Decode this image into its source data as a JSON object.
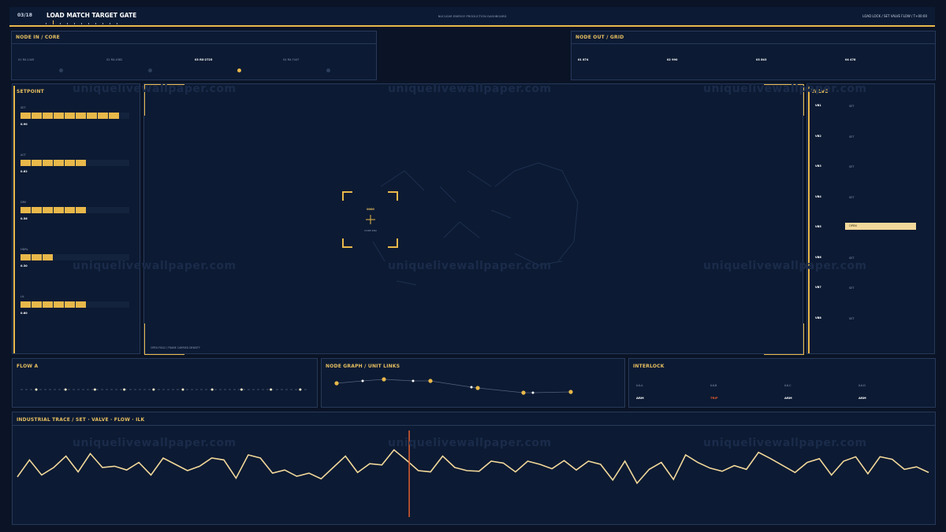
{
  "header": {
    "page_counter": "03/18",
    "title": "LOAD MATCH TARGET GATE",
    "subtitle": "NUCLEAR ENERGY PRODUCTION DASHBOARD",
    "right_status": "LOAD LOCK / SET VALVE FLOW / T+00:00"
  },
  "node_in": {
    "title": "NODE IN / CORE",
    "items": [
      {
        "label": "01 RX-1445",
        "active": false
      },
      {
        "label": "02 RX-4382",
        "active": false
      },
      {
        "label": "03 RX-2725",
        "active": true
      },
      {
        "label": "04 RX-7447",
        "active": false
      }
    ]
  },
  "node_out": {
    "title": "NODE OUT / GRID",
    "items": [
      "01 874",
      "02 990",
      "03 843",
      "04 478"
    ]
  },
  "setpoint": {
    "title": "SETPOINT",
    "rows": [
      {
        "label": "SET",
        "value": "0.90",
        "fill": 0.9
      },
      {
        "label": "ACT",
        "value": "0.62",
        "fill": 0.6
      },
      {
        "label": "DRV",
        "value": "0.56",
        "fill": 0.6
      },
      {
        "label": "HDRL",
        "value": "0.30",
        "fill": 0.3
      },
      {
        "label": "LIL",
        "value": "0.60",
        "fill": 0.6
      }
    ]
  },
  "center": {
    "reticle_label": "0000",
    "reticle_sub": "CORE ZNA",
    "footer": "OPEN FIELD / FRAME CARRIED DENSITY"
  },
  "valve": {
    "title": "VALVE",
    "rows": [
      {
        "id": "VB1",
        "state": "SET",
        "open": false
      },
      {
        "id": "VB2",
        "state": "SET",
        "open": false
      },
      {
        "id": "VB3",
        "state": "SET",
        "open": false
      },
      {
        "id": "VB4",
        "state": "SET",
        "open": false
      },
      {
        "id": "VB5",
        "state": "OPEN",
        "open": true
      },
      {
        "id": "VB6",
        "state": "SET",
        "open": false
      },
      {
        "id": "VB7",
        "state": "SET",
        "open": false
      },
      {
        "id": "VB8",
        "state": "SET",
        "open": false
      }
    ]
  },
  "flow": {
    "title": "FLOW A",
    "dots": 10
  },
  "node_graph": {
    "title": "NODE GRAPH / UNIT LINKS"
  },
  "interlock": {
    "title": "INTERLOCK",
    "items": [
      {
        "id": "ILK-A",
        "state": "ARM",
        "trip": false
      },
      {
        "id": "ILK-B",
        "state": "TRIP",
        "trip": true
      },
      {
        "id": "ILK-C",
        "state": "ARM",
        "trip": false
      },
      {
        "id": "ILK-D",
        "state": "ARM",
        "trip": false
      }
    ]
  },
  "trace": {
    "title": "INDUSTRIAL TRACE / SET · VALVE · FLOW · ILK",
    "values": [
      0.35,
      0.62,
      0.38,
      0.5,
      0.68,
      0.43,
      0.72,
      0.5,
      0.52,
      0.46,
      0.58,
      0.38,
      0.65,
      0.55,
      0.45,
      0.52,
      0.65,
      0.62,
      0.33,
      0.7,
      0.65,
      0.41,
      0.46,
      0.36,
      0.41,
      0.32,
      0.5,
      0.68,
      0.42,
      0.56,
      0.54,
      0.78,
      0.62,
      0.45,
      0.43,
      0.68,
      0.5,
      0.45,
      0.44,
      0.6,
      0.57,
      0.43,
      0.6,
      0.55,
      0.48,
      0.61,
      0.46,
      0.6,
      0.55,
      0.3,
      0.6,
      0.25,
      0.47,
      0.58,
      0.31,
      0.7,
      0.58,
      0.49,
      0.44,
      0.53,
      0.47,
      0.74,
      0.64,
      0.53,
      0.42,
      0.58,
      0.64,
      0.38,
      0.6,
      0.67,
      0.4,
      0.67,
      0.63,
      0.47,
      0.51,
      0.42
    ],
    "cursor_pos": 0.43,
    "line_color": "#f2d89a",
    "cursor_color": "#e06030"
  },
  "watermark": "uniquelivewallpaper.com",
  "colors": {
    "accent": "#e8b84a",
    "panel": "#0c1a33",
    "border": "#27395a",
    "trip": "#e05a2a"
  }
}
